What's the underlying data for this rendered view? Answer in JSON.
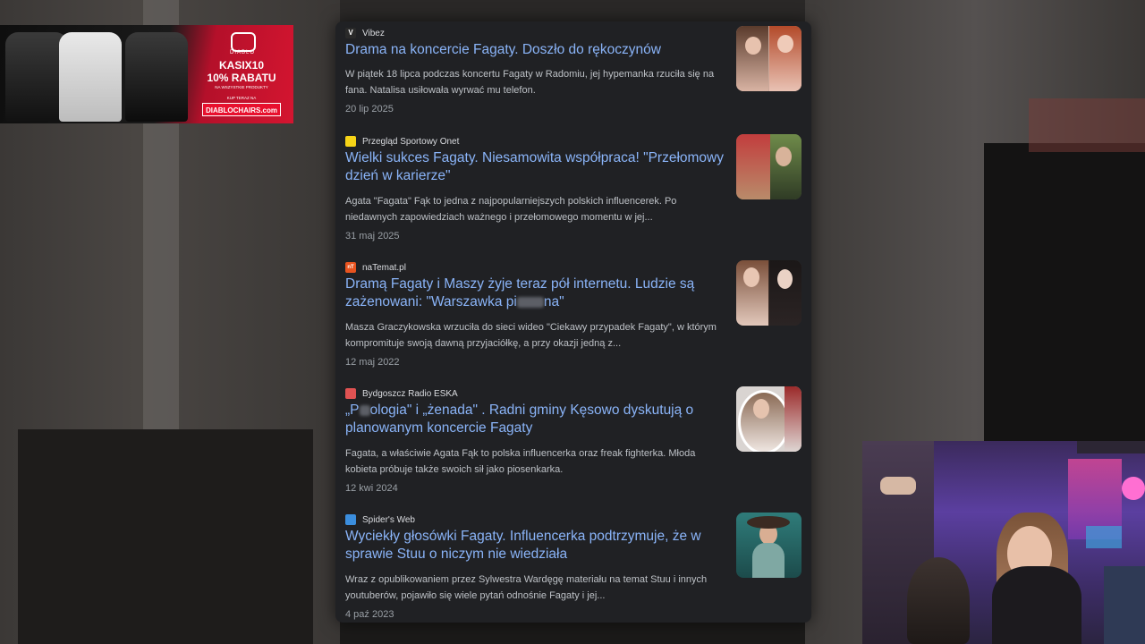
{
  "ad": {
    "brand": "DIABLO",
    "code": "KASIX10",
    "discount": "10% RABATU",
    "subtext": "NA WSZYSTKIE PRODUKTY",
    "cta": "KUP TERAZ NA",
    "url": "DIABLOCHAIRS.com"
  },
  "results": [
    {
      "source": "Vibez",
      "favicon_color": "#2a2a2a",
      "favicon_char": "V",
      "title": "Drama na koncercie Fagaty. Doszło do rękoczynów",
      "snippet": "W piątek 18 lipca podczas koncertu Fagaty w Radomiu, jej hypemanka rzuciła się na fana. Natalisa usiłowała wyrwać mu telefon.",
      "date": "20 lip 2025",
      "thumb_icon": "two-women-photo-icon"
    },
    {
      "source": "Przegląd Sportowy Onet",
      "favicon_color": "#f7d417",
      "favicon_char": "",
      "title": "Wielki sukces Fagaty. Niesamowita współpraca! \"Przełomowy dzień w karierze\"",
      "snippet": "Agata \"Fagata\" Fąk to jedna z najpopularniejszych polskich influencerek. Po niedawnych zapowiedziach ważnego i przełomowego momentu w jej...",
      "date": "31 maj 2025",
      "thumb_icon": "collage-photo-icon"
    },
    {
      "source": "naTemat.pl",
      "favicon_color": "#e8531f",
      "favicon_char": "nT",
      "title_part1": "Dramą Fagaty i Maszy żyje teraz pół internetu. Ludzie są zażenowani: \"Warszawka pi",
      "title_part2": "na\"",
      "snippet": "Masza Graczykowska wrzuciła do sieci wideo \"Ciekawy przypadek Fagaty\", w którym kompromituje swoją dawną przyjaciółkę, a przy okazji jedną z...",
      "date": "12 maj 2022",
      "thumb_icon": "two-women-photo-icon"
    },
    {
      "source": "Bydgoszcz Radio ESKA",
      "favicon_color": "#e05252",
      "favicon_char": "",
      "title_part1": "„P",
      "title_part2": "ologia\" i „żenada\" . Radni gminy Kęsowo dyskutują o planowanym koncercie Fagaty",
      "snippet": "Fagata, a właściwie Agata Fąk to polska influencerka oraz freak fighterka. Młoda kobieta próbuje także swoich sił jako piosenkarka.",
      "date": "12 kwi 2024",
      "thumb_icon": "woman-portrait-photo-icon"
    },
    {
      "source": "Spider's Web",
      "favicon_color": "#3b8ede",
      "favicon_char": "",
      "title": "Wyciekły głosówki Fagaty. Influencerka podtrzymuje, że w sprawie Stuu o niczym nie wiedziała",
      "snippet": "Wraz z opublikowaniem przez Sylwestra Wardęgę materiału na temat Stuu i innych youtuberów, pojawiło się wiele pytań odnośnie Fagaty i jej...",
      "date": "4 paź 2023",
      "thumb_icon": "woman-poolside-photo-icon"
    }
  ]
}
